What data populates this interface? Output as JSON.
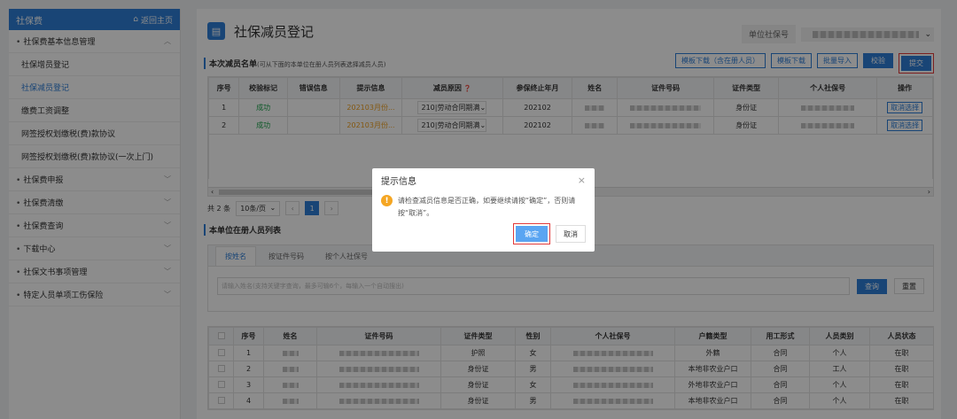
{
  "sidebar": {
    "title": "社保费",
    "home_label": "返回主页",
    "items": [
      {
        "label": "社保费基本信息管理",
        "type": "group",
        "arrow": "^"
      },
      {
        "label": "社保增员登记",
        "type": "sub"
      },
      {
        "label": "社保减员登记",
        "type": "sub",
        "active": true
      },
      {
        "label": "缴费工资调整",
        "type": "sub"
      },
      {
        "label": "网签授权划缴税(费)款协议",
        "type": "sub"
      },
      {
        "label": "网签授权划缴税(费)款协议(一次上门)",
        "type": "sub"
      },
      {
        "label": "社保费申报",
        "type": "group",
        "arrow": "v"
      },
      {
        "label": "社保费清缴",
        "type": "group",
        "arrow": "v"
      },
      {
        "label": "社保费查询",
        "type": "group",
        "arrow": "v"
      },
      {
        "label": "下载中心",
        "type": "group",
        "arrow": "v"
      },
      {
        "label": "社保文书事项管理",
        "type": "group",
        "arrow": "v"
      },
      {
        "label": "特定人员单项工伤保险",
        "type": "group",
        "arrow": "v"
      }
    ]
  },
  "header": {
    "title": "社保减员登记",
    "unit_label": "单位社保号"
  },
  "reduction_section": {
    "title": "本次减员名单",
    "subtitle": "(可从下面的本单位在册人员列表选择减员人员)",
    "buttons": {
      "template_download_with": "模板下载（含在册人员）",
      "template_download": "模板下载",
      "batch_import": "批量导入",
      "verify": "校验",
      "submit": "提交"
    },
    "columns": [
      "序号",
      "校验标记",
      "错误信息",
      "提示信息",
      "减员原因",
      "参保终止年月",
      "姓名",
      "证件号码",
      "证件类型",
      "个人社保号",
      "操作"
    ],
    "rows": [
      {
        "no": "1",
        "mark": "成功",
        "error": "",
        "hint": "202103月份...",
        "reason": "210|劳动合同期满",
        "end": "202102",
        "type": "身份证",
        "action": "取消选择"
      },
      {
        "no": "2",
        "mark": "成功",
        "error": "",
        "hint": "202103月份...",
        "reason": "210|劳动合同期满",
        "end": "202102",
        "type": "身份证",
        "action": "取消选择"
      }
    ]
  },
  "pager": {
    "total": "共 2 条",
    "page_size": "10条/页",
    "current": "1"
  },
  "registered_section": {
    "title": "本单位在册人员列表",
    "tabs": [
      "按姓名",
      "按证件号码",
      "按个人社保号"
    ],
    "search_placeholder": "请输入姓名(支持关键字查询，最多可输6个，每输入一个自动搜出)",
    "query": "查询",
    "reset": "重置",
    "columns": [
      "",
      "序号",
      "姓名",
      "证件号码",
      "证件类型",
      "性别",
      "个人社保号",
      "户籍类型",
      "用工形式",
      "人员类别",
      "人员状态"
    ],
    "rows": [
      {
        "no": "1",
        "type": "护照",
        "sex": "女",
        "huji": "外籍",
        "form": "合同",
        "cat": "个人",
        "status": "在职"
      },
      {
        "no": "2",
        "type": "身份证",
        "sex": "男",
        "huji": "本地非农业户口",
        "form": "合同",
        "cat": "工人",
        "status": "在职"
      },
      {
        "no": "3",
        "type": "身份证",
        "sex": "女",
        "huji": "外地非农业户口",
        "form": "合同",
        "cat": "个人",
        "status": "在职"
      },
      {
        "no": "4",
        "type": "身份证",
        "sex": "男",
        "huji": "本地非农业户口",
        "form": "合同",
        "cat": "个人",
        "status": "在职"
      }
    ]
  },
  "dialog": {
    "title": "提示信息",
    "close": "×",
    "message": "请检查减员信息是否正确，如要继续请按“确定”，否则请按“取消”。",
    "confirm": "确定",
    "cancel": "取消"
  },
  "colors": {
    "primary": "#2f7fd8",
    "success": "#1aa34a",
    "warning": "#f5a623",
    "highlight": "#e23b3b"
  }
}
